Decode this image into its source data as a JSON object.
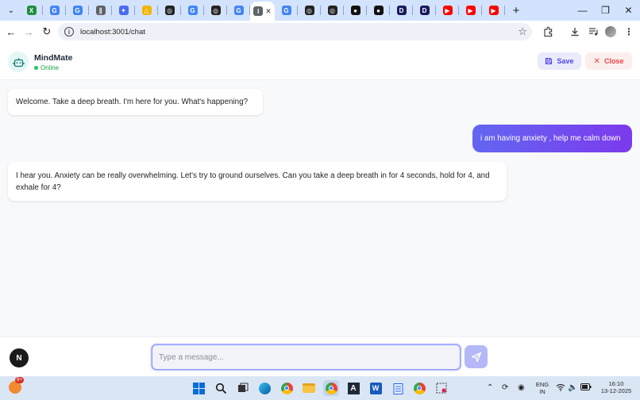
{
  "browser": {
    "tabs": [
      {
        "icon": "chevron-down-icon",
        "kind": "menu"
      },
      {
        "icon": "sheets-icon",
        "color": "#1e8e3e",
        "letter": "X"
      },
      {
        "icon": "google-icon",
        "color": "#4285f4",
        "letter": "G"
      },
      {
        "icon": "google-icon",
        "color": "#4285f4",
        "letter": "G"
      },
      {
        "icon": "extension-tab-icon",
        "color": "#5f6368",
        "letter": "∥"
      },
      {
        "icon": "gemini-icon",
        "color": "#4b6cf0",
        "letter": "✦"
      },
      {
        "icon": "drive-icon",
        "color": "#f4b400",
        "letter": "△"
      },
      {
        "icon": "chatgpt-icon",
        "color": "#222222",
        "letter": "◎"
      },
      {
        "icon": "google-icon",
        "color": "#4285f4",
        "letter": "G"
      },
      {
        "icon": "chatgpt-icon",
        "color": "#222222",
        "letter": "◎"
      },
      {
        "icon": "google-icon",
        "color": "#4285f4",
        "letter": "G"
      },
      {
        "icon": "active-tab-icon",
        "color": "#5f6368",
        "letter": "I",
        "active": true
      },
      {
        "icon": "google-icon",
        "color": "#4285f4",
        "letter": "G"
      },
      {
        "icon": "chatgpt-icon",
        "color": "#222222",
        "letter": "◎"
      },
      {
        "icon": "chatgpt-icon",
        "color": "#222222",
        "letter": "◎"
      },
      {
        "icon": "github-icon",
        "color": "#111111",
        "letter": "●"
      },
      {
        "icon": "github-icon",
        "color": "#111111",
        "letter": "●"
      },
      {
        "icon": "d-icon",
        "color": "#1a1a5e",
        "letter": "D"
      },
      {
        "icon": "d-icon",
        "color": "#1a1a5e",
        "letter": "D"
      },
      {
        "icon": "youtube-icon",
        "color": "#ff0000",
        "letter": "▶"
      },
      {
        "icon": "youtube-icon",
        "color": "#ff0000",
        "letter": "▶"
      },
      {
        "icon": "youtube-icon",
        "color": "#ff0000",
        "letter": "▶"
      }
    ],
    "url": "localhost:3001/chat"
  },
  "app": {
    "name": "MindMate",
    "status": "Online",
    "save_label": "Save",
    "close_label": "Close",
    "accent": "#6366f1"
  },
  "messages": [
    {
      "role": "bot",
      "text": "Welcome. Take a deep breath. I'm here for you. What's happening?"
    },
    {
      "role": "user",
      "text": "i am having anxiety , help me calm down"
    },
    {
      "role": "bot",
      "text": "I hear you. Anxiety can be really overwhelming. Let's try to ground ourselves. Can you take a deep breath in for 4 seconds, hold for 4, and exhale for 4?"
    }
  ],
  "composer": {
    "placeholder": "Type a message...",
    "avatar_letter": "N"
  },
  "taskbar": {
    "weather_badge": "9+",
    "lang_top": "ENG",
    "lang_bottom": "IN",
    "time": "16:10",
    "date": "13-12-2025"
  }
}
